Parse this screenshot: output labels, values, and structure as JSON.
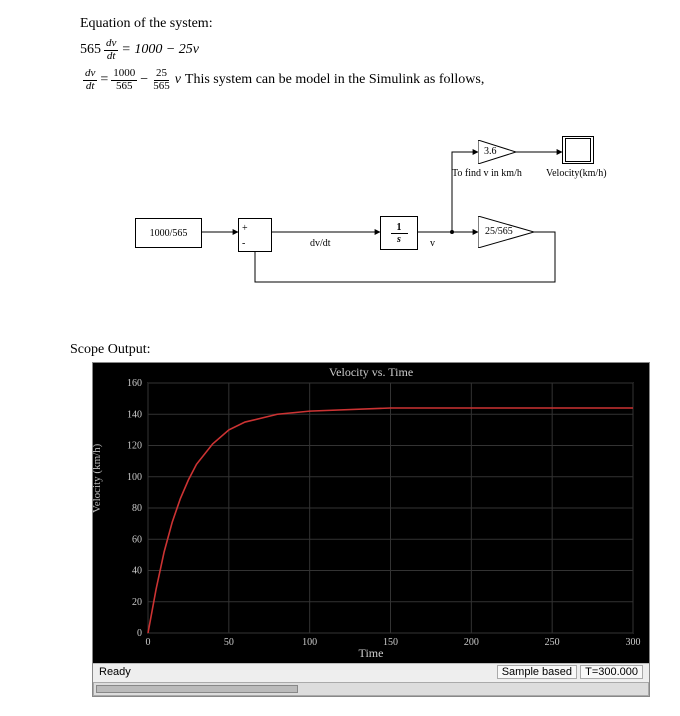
{
  "equations": {
    "heading": "Equation of the system:",
    "eq1_lhs_coeff": "565",
    "eq1_frac_num": "dv",
    "eq1_frac_den": "dt",
    "eq1_rhs": "= 1000 − 25v",
    "eq2_left_num": "dv",
    "eq2_left_den": "dt",
    "eq2_eq": "=",
    "eq2_t1_num": "1000",
    "eq2_t1_den": "565",
    "eq2_minus": "−",
    "eq2_t2_num": "25",
    "eq2_t2_den": "565",
    "eq2_trail": "v",
    "follow_text": "This system can be model in the Simulink as follows,"
  },
  "diagram": {
    "const_block": "1000/565",
    "sum_plus": "+",
    "sum_minus": "-",
    "dvdt_label": "dv/dt",
    "integrator_num": "1",
    "integrator_den": "s",
    "v_label": "v",
    "gain_fb": "25/565",
    "gain_top": "3.6",
    "top_note": "To find v in km/h",
    "scope_name": "Velocity(km/h)"
  },
  "scope_section_title": "Scope Output:",
  "chart_data": {
    "type": "line",
    "title": "Velocity vs. Time",
    "xlabel": "Time",
    "ylabel": "Velocity (km/h)",
    "xlim": [
      0,
      300
    ],
    "ylim": [
      0,
      160
    ],
    "x_ticks": [
      0,
      50,
      100,
      150,
      200,
      250,
      300
    ],
    "y_ticks": [
      0,
      20,
      40,
      60,
      80,
      100,
      120,
      140,
      160
    ],
    "x": [
      0,
      5,
      10,
      15,
      20,
      25,
      30,
      40,
      50,
      60,
      80,
      100,
      150,
      200,
      250,
      300
    ],
    "values": [
      0,
      28,
      52,
      71,
      86,
      98,
      108,
      121,
      130,
      135,
      140,
      142,
      144,
      144,
      144,
      144
    ],
    "series_color": "#cc3333"
  },
  "status": {
    "ready": "Ready",
    "sample": "Sample based",
    "time": "T=300.000"
  }
}
